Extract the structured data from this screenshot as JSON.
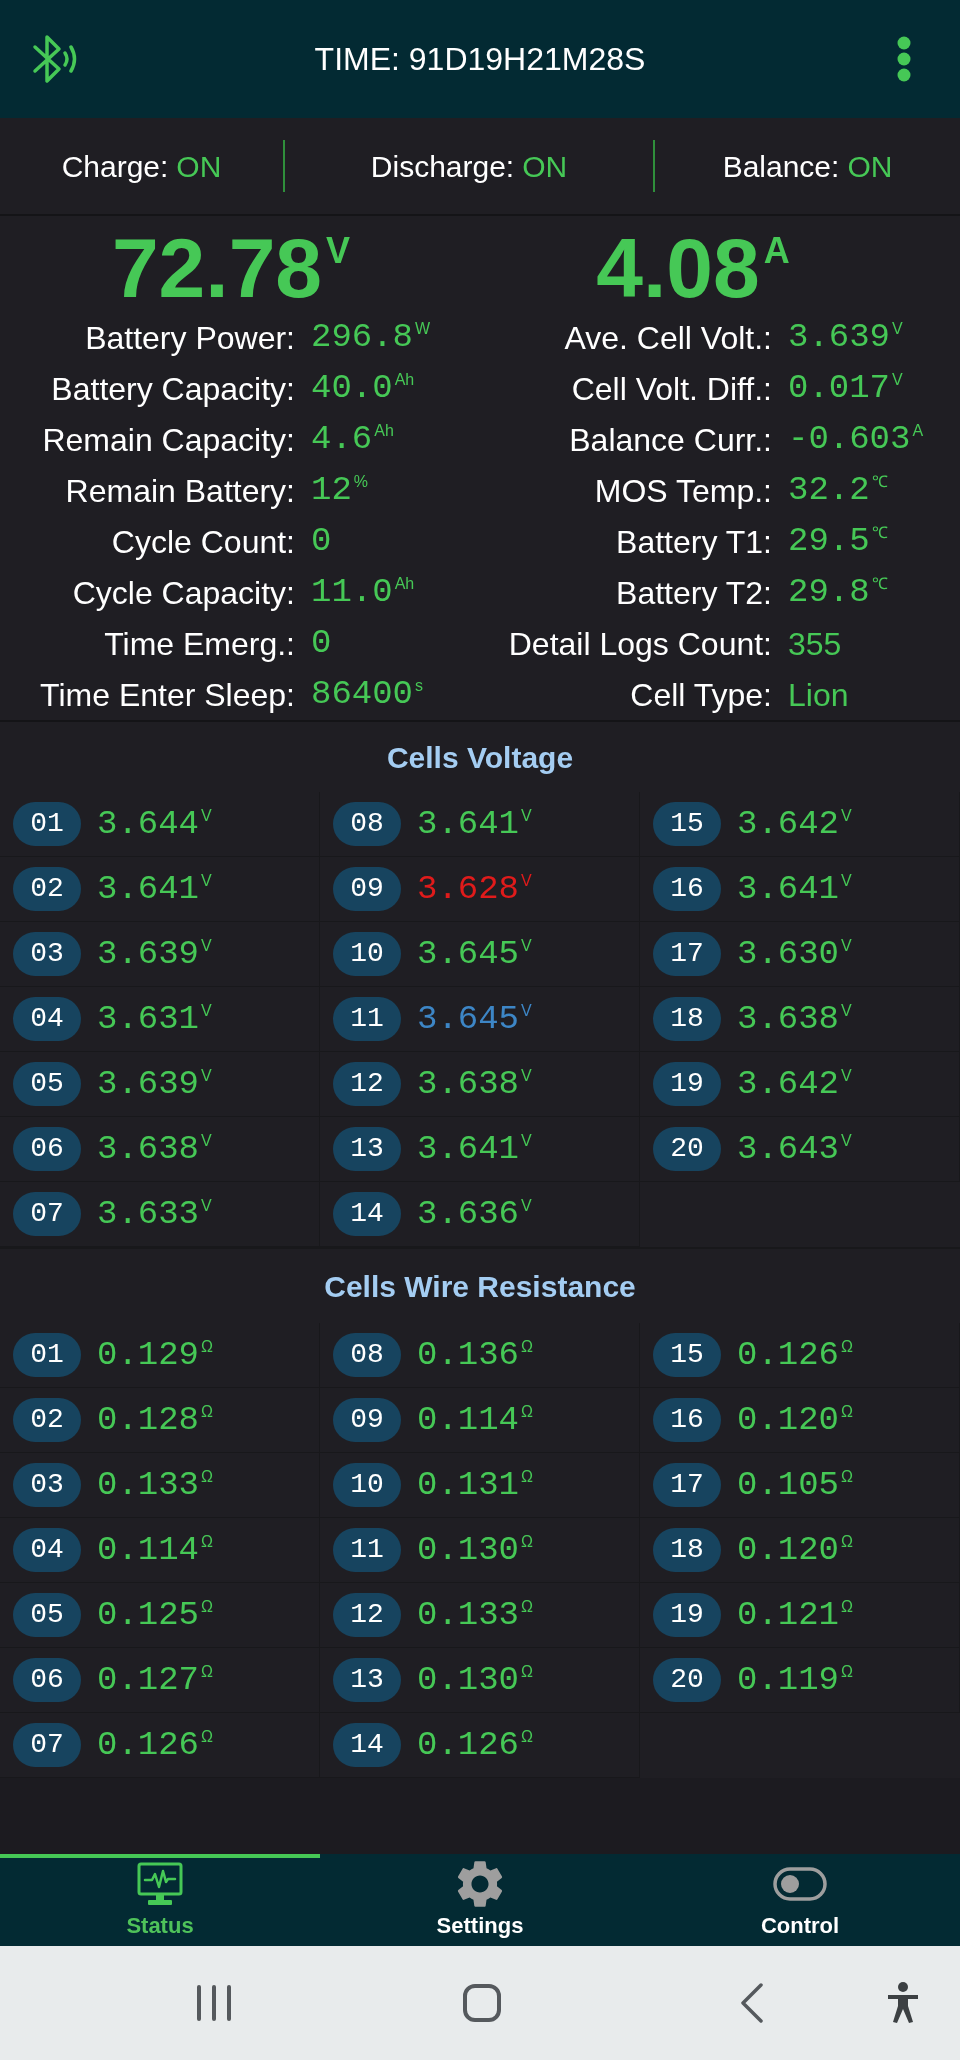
{
  "header": {
    "title": "TIME: 91D19H21M28S"
  },
  "switches": [
    {
      "label": "Charge:",
      "value": "ON",
      "on": true
    },
    {
      "label": "Discharge:",
      "value": "ON",
      "on": true
    },
    {
      "label": "Balance:",
      "value": "ON",
      "on": true
    }
  ],
  "main_readings": [
    {
      "value": "72.78",
      "unit": "V"
    },
    {
      "value": "4.08",
      "unit": "A"
    }
  ],
  "stats_left": [
    {
      "label": "Battery Power:",
      "value": "296.8",
      "unit": "W",
      "kind": "number"
    },
    {
      "label": "Battery Capacity:",
      "value": "40.0",
      "unit": "Ah",
      "kind": "number"
    },
    {
      "label": "Remain Capacity:",
      "value": "4.6",
      "unit": "Ah",
      "kind": "number"
    },
    {
      "label": "Remain Battery:",
      "value": "12",
      "unit": "%",
      "kind": "number"
    },
    {
      "label": "Cycle Count:",
      "value": "0",
      "kind": "number"
    },
    {
      "label": "Cycle Capacity:",
      "value": "11.0",
      "unit": "Ah",
      "kind": "number"
    },
    {
      "label": "Time Emerg.:",
      "value": "0",
      "kind": "number"
    },
    {
      "label": "Time Enter Sleep:",
      "value": "86400",
      "unit": "s",
      "kind": "number"
    }
  ],
  "stats_right": [
    {
      "label": "Ave. Cell Volt.:",
      "value": "3.639",
      "unit": "V",
      "kind": "number"
    },
    {
      "label": "Cell Volt. Diff.:",
      "value": "0.017",
      "unit": "V",
      "kind": "number"
    },
    {
      "label": "Balance Curr.:",
      "value": "-0.603",
      "unit": "A",
      "kind": "number"
    },
    {
      "label": "MOS Temp.:",
      "value": "32.2",
      "unit": "℃",
      "kind": "number"
    },
    {
      "label": "Battery T1:",
      "value": "29.5",
      "unit": "℃",
      "kind": "number"
    },
    {
      "label": "Battery T2:",
      "value": "29.8",
      "unit": "℃",
      "kind": "number"
    },
    {
      "label": "Detail Logs Count:",
      "value": "355",
      "kind": "text"
    },
    {
      "label": "Cell Type:",
      "value": "Lion",
      "kind": "text"
    }
  ],
  "cells_voltage": {
    "title": "Cells Voltage",
    "cells": [
      {
        "number": "01",
        "value": "3.644",
        "unit": "V",
        "color": "#46c856"
      },
      {
        "number": "02",
        "value": "3.641",
        "unit": "V",
        "color": "#46c856"
      },
      {
        "number": "03",
        "value": "3.639",
        "unit": "V",
        "color": "#46c856"
      },
      {
        "number": "04",
        "value": "3.631",
        "unit": "V",
        "color": "#46c856"
      },
      {
        "number": "05",
        "value": "3.639",
        "unit": "V",
        "color": "#46c856"
      },
      {
        "number": "06",
        "value": "3.638",
        "unit": "V",
        "color": "#46c856"
      },
      {
        "number": "07",
        "value": "3.633",
        "unit": "V",
        "color": "#46c856"
      },
      {
        "number": "08",
        "value": "3.641",
        "unit": "V",
        "color": "#46c856"
      },
      {
        "number": "09",
        "value": "3.628",
        "unit": "V",
        "color": "#e01b1b"
      },
      {
        "number": "10",
        "value": "3.645",
        "unit": "V",
        "color": "#46c856"
      },
      {
        "number": "11",
        "value": "3.645",
        "unit": "V",
        "color": "#3d86c6"
      },
      {
        "number": "12",
        "value": "3.638",
        "unit": "V",
        "color": "#46c856"
      },
      {
        "number": "13",
        "value": "3.641",
        "unit": "V",
        "color": "#46c856"
      },
      {
        "number": "14",
        "value": "3.636",
        "unit": "V",
        "color": "#46c856"
      },
      {
        "number": "15",
        "value": "3.642",
        "unit": "V",
        "color": "#46c856"
      },
      {
        "number": "16",
        "value": "3.641",
        "unit": "V",
        "color": "#46c856"
      },
      {
        "number": "17",
        "value": "3.630",
        "unit": "V",
        "color": "#46c856"
      },
      {
        "number": "18",
        "value": "3.638",
        "unit": "V",
        "color": "#46c856"
      },
      {
        "number": "19",
        "value": "3.642",
        "unit": "V",
        "color": "#46c856"
      },
      {
        "number": "20",
        "value": "3.643",
        "unit": "V",
        "color": "#46c856"
      }
    ]
  },
  "cells_wire_resistance": {
    "title": "Cells Wire Resistance",
    "cells": [
      {
        "number": "01",
        "value": "0.129",
        "unit": "Ω"
      },
      {
        "number": "02",
        "value": "0.128",
        "unit": "Ω"
      },
      {
        "number": "03",
        "value": "0.133",
        "unit": "Ω"
      },
      {
        "number": "04",
        "value": "0.114",
        "unit": "Ω"
      },
      {
        "number": "05",
        "value": "0.125",
        "unit": "Ω"
      },
      {
        "number": "06",
        "value": "0.127",
        "unit": "Ω"
      },
      {
        "number": "07",
        "value": "0.126",
        "unit": "Ω"
      },
      {
        "number": "08",
        "value": "0.136",
        "unit": "Ω"
      },
      {
        "number": "09",
        "value": "0.114",
        "unit": "Ω"
      },
      {
        "number": "10",
        "value": "0.131",
        "unit": "Ω"
      },
      {
        "number": "11",
        "value": "0.130",
        "unit": "Ω"
      },
      {
        "number": "12",
        "value": "0.133",
        "unit": "Ω"
      },
      {
        "number": "13",
        "value": "0.130",
        "unit": "Ω"
      },
      {
        "number": "14",
        "value": "0.126",
        "unit": "Ω"
      },
      {
        "number": "15",
        "value": "0.126",
        "unit": "Ω"
      },
      {
        "number": "16",
        "value": "0.120",
        "unit": "Ω"
      },
      {
        "number": "17",
        "value": "0.105",
        "unit": "Ω"
      },
      {
        "number": "18",
        "value": "0.120",
        "unit": "Ω"
      },
      {
        "number": "19",
        "value": "0.121",
        "unit": "Ω"
      },
      {
        "number": "20",
        "value": "0.119",
        "unit": "Ω"
      }
    ]
  },
  "bottom_nav": [
    {
      "label": "Status",
      "selected": true
    },
    {
      "label": "Settings",
      "selected": false
    },
    {
      "label": "Control",
      "selected": false
    }
  ]
}
